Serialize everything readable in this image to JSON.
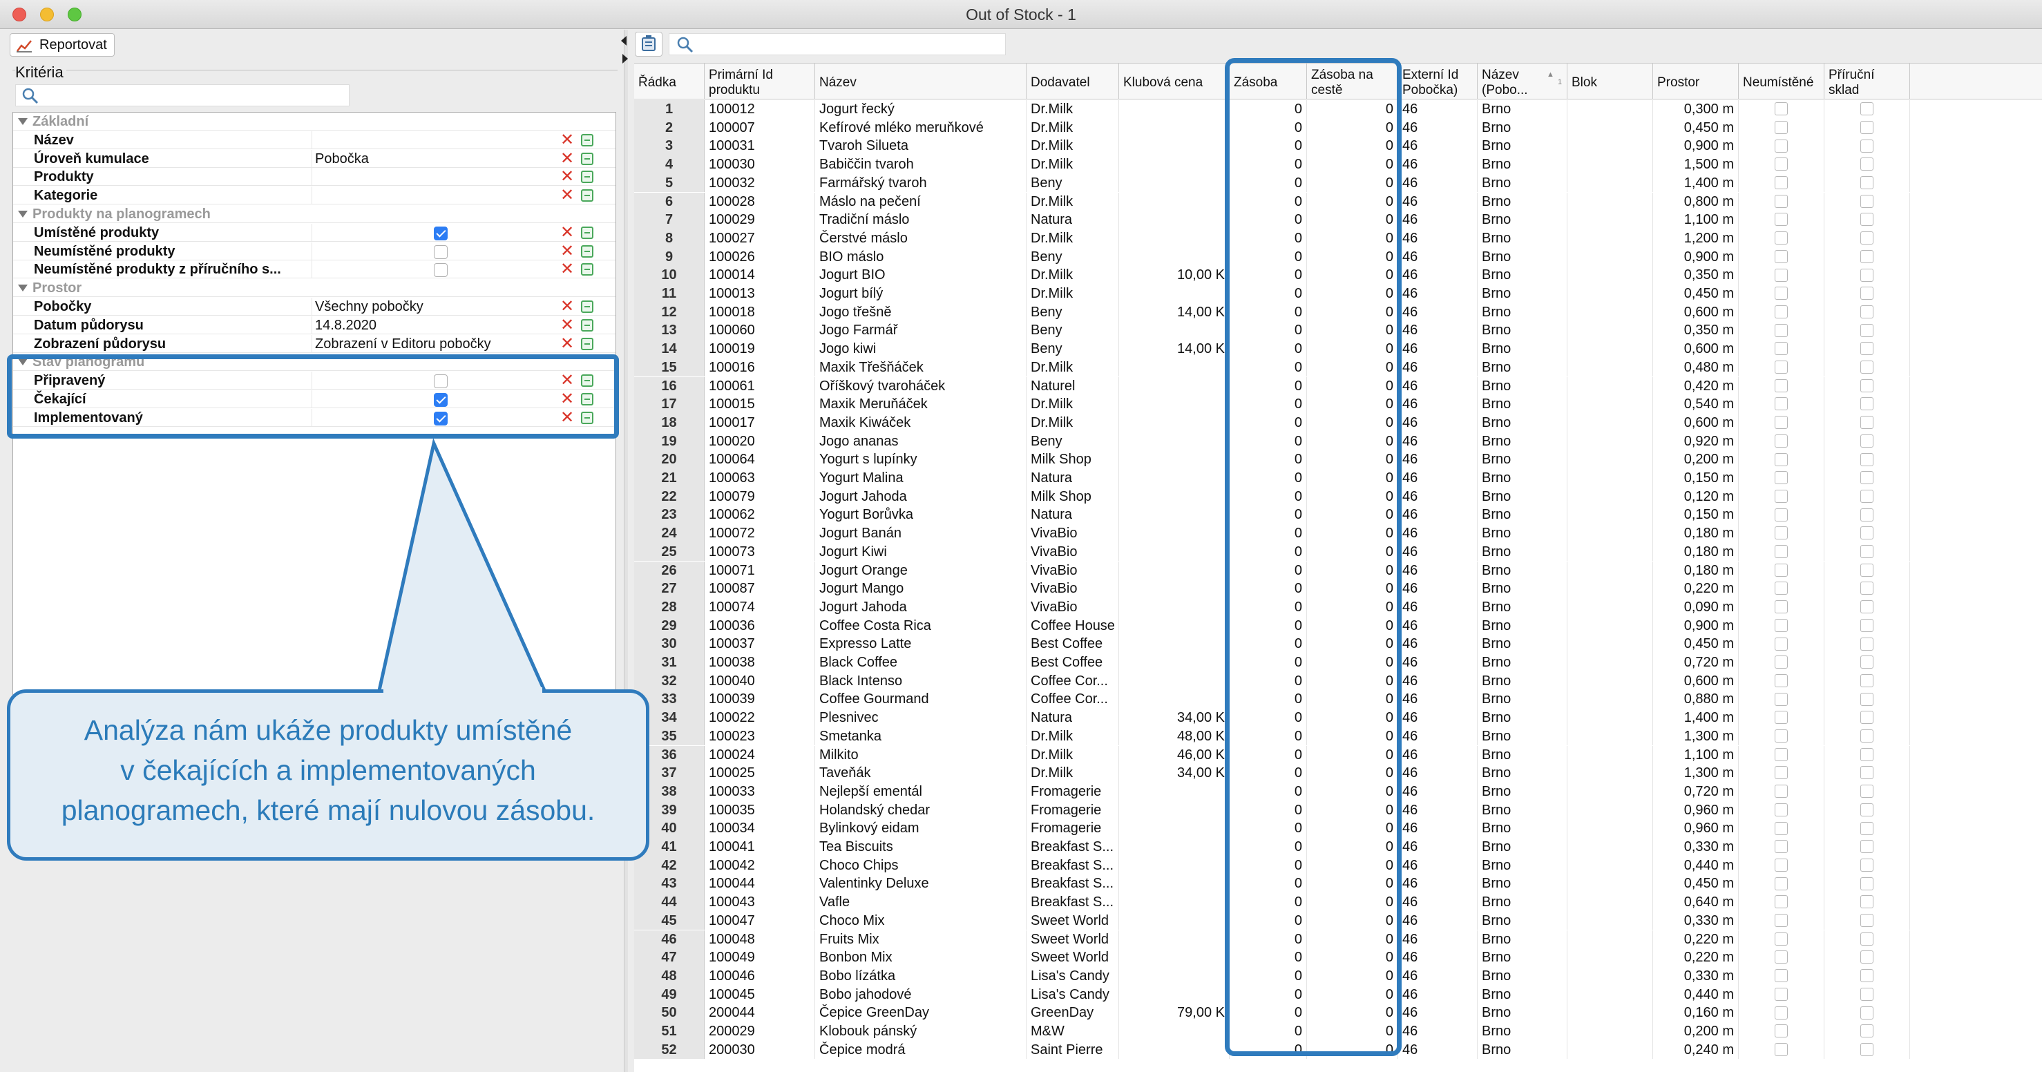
{
  "window": {
    "title": "Out of Stock - 1"
  },
  "left_panel": {
    "report_button": "Reportovat",
    "criteria_title": "Kritéria",
    "rows": [
      {
        "type": "group",
        "label": "Základní"
      },
      {
        "type": "item",
        "label": "Název",
        "value": "",
        "checkbox": null
      },
      {
        "type": "item",
        "label": "Úroveň kumulace",
        "value": "Pobočka",
        "checkbox": null
      },
      {
        "type": "item",
        "label": "Produkty",
        "value": "",
        "checkbox": null
      },
      {
        "type": "item",
        "label": "Kategorie",
        "value": "",
        "checkbox": null
      },
      {
        "type": "group",
        "label": "Produkty na planogramech"
      },
      {
        "type": "item",
        "label": "Umístěné produkty",
        "value": "",
        "checkbox": true
      },
      {
        "type": "item",
        "label": "Neumístěné produkty",
        "value": "",
        "checkbox": false
      },
      {
        "type": "item",
        "label": "Neumístěné produkty z příručního s...",
        "value": "",
        "checkbox": false
      },
      {
        "type": "group",
        "label": "Prostor"
      },
      {
        "type": "item",
        "label": "Pobočky",
        "value": "Všechny pobočky",
        "checkbox": null
      },
      {
        "type": "item",
        "label": "Datum půdorysu",
        "value": "14.8.2020",
        "checkbox": null
      },
      {
        "type": "item",
        "label": "Zobrazení půdorysu",
        "value": "Zobrazení v Editoru pobočky",
        "checkbox": null
      },
      {
        "type": "group",
        "label": "Stav planogramu"
      },
      {
        "type": "item",
        "label": "Připravený",
        "value": "",
        "checkbox": false
      },
      {
        "type": "item",
        "label": "Čekající",
        "value": "",
        "checkbox": true
      },
      {
        "type": "item",
        "label": "Implementovaný",
        "value": "",
        "checkbox": true
      }
    ]
  },
  "callout": {
    "lines": [
      "Analýza nám ukáže produkty umístěné",
      "v čekajících a implementovaných",
      "planogramech, které mají nulovou zásobu."
    ]
  },
  "colors": {
    "highlight": "#2f7bbd",
    "callout_bg": "#e3edf5",
    "checkbox_on": "#2c7df4",
    "remove": "#d9352a"
  },
  "table": {
    "columns": [
      "Řádka",
      "Primární Id\nproduktu",
      "Název",
      "Dodavatel",
      "Klubová cena",
      "Zásoba",
      "Zásoba na\ncestě",
      "Externí Id\nPobočka)",
      "Název\n(Pobo...",
      "Blok",
      "Prostor",
      "Neumístěné",
      "Příruční\nsklad"
    ],
    "sort_indicator": "1",
    "rows": [
      [
        "1",
        "100012",
        "Jogurt řecký",
        "Dr.Milk",
        "",
        "0",
        "0",
        "46",
        "Brno",
        "",
        "0,300 m"
      ],
      [
        "2",
        "100007",
        "Kefírové mléko meruňkové",
        "Dr.Milk",
        "",
        "0",
        "0",
        "46",
        "Brno",
        "",
        "0,450 m"
      ],
      [
        "3",
        "100031",
        "Tvaroh Silueta",
        "Dr.Milk",
        "",
        "0",
        "0",
        "46",
        "Brno",
        "",
        "0,900 m"
      ],
      [
        "4",
        "100030",
        "Babiččin tvaroh",
        "Dr.Milk",
        "",
        "0",
        "0",
        "46",
        "Brno",
        "",
        "1,500 m"
      ],
      [
        "5",
        "100032",
        "Farmářský tvaroh",
        "Beny",
        "",
        "0",
        "0",
        "46",
        "Brno",
        "",
        "1,400 m"
      ],
      [
        "6",
        "100028",
        "Máslo na pečení",
        "Dr.Milk",
        "",
        "0",
        "0",
        "46",
        "Brno",
        "",
        "0,800 m"
      ],
      [
        "7",
        "100029",
        "Tradiční máslo",
        "Natura",
        "",
        "0",
        "0",
        "46",
        "Brno",
        "",
        "1,100 m"
      ],
      [
        "8",
        "100027",
        "Čerstvé máslo",
        "Dr.Milk",
        "",
        "0",
        "0",
        "46",
        "Brno",
        "",
        "1,200 m"
      ],
      [
        "9",
        "100026",
        "BIO máslo",
        "Beny",
        "",
        "0",
        "0",
        "46",
        "Brno",
        "",
        "0,900 m"
      ],
      [
        "10",
        "100014",
        "Jogurt BIO",
        "Dr.Milk",
        "10,00 K",
        "0",
        "0",
        "46",
        "Brno",
        "",
        "0,350 m"
      ],
      [
        "11",
        "100013",
        "Jogurt bílý",
        "Dr.Milk",
        "",
        "0",
        "0",
        "46",
        "Brno",
        "",
        "0,450 m"
      ],
      [
        "12",
        "100018",
        "Jogo třešně",
        "Beny",
        "14,00 K",
        "0",
        "0",
        "46",
        "Brno",
        "",
        "0,600 m"
      ],
      [
        "13",
        "100060",
        "Jogo Farmář",
        "Beny",
        "",
        "0",
        "0",
        "46",
        "Brno",
        "",
        "0,350 m"
      ],
      [
        "14",
        "100019",
        "Jogo kiwi",
        "Beny",
        "14,00 K",
        "0",
        "0",
        "46",
        "Brno",
        "",
        "0,600 m"
      ],
      [
        "15",
        "100016",
        "Maxik Třešňáček",
        "Dr.Milk",
        "",
        "0",
        "0",
        "46",
        "Brno",
        "",
        "0,480 m"
      ],
      [
        "16",
        "100061",
        "Oříškový tvaroháček",
        "Naturel",
        "",
        "0",
        "0",
        "46",
        "Brno",
        "",
        "0,420 m"
      ],
      [
        "17",
        "100015",
        "Maxik Meruňáček",
        "Dr.Milk",
        "",
        "0",
        "0",
        "46",
        "Brno",
        "",
        "0,540 m"
      ],
      [
        "18",
        "100017",
        "Maxik Kiwáček",
        "Dr.Milk",
        "",
        "0",
        "0",
        "46",
        "Brno",
        "",
        "0,600 m"
      ],
      [
        "19",
        "100020",
        "Jogo ananas",
        "Beny",
        "",
        "0",
        "0",
        "46",
        "Brno",
        "",
        "0,920 m"
      ],
      [
        "20",
        "100064",
        "Yogurt s lupínky",
        "Milk Shop",
        "",
        "0",
        "0",
        "46",
        "Brno",
        "",
        "0,200 m"
      ],
      [
        "21",
        "100063",
        "Yogurt Malina",
        "Natura",
        "",
        "0",
        "0",
        "46",
        "Brno",
        "",
        "0,150 m"
      ],
      [
        "22",
        "100079",
        "Jogurt Jahoda",
        "Milk Shop",
        "",
        "0",
        "0",
        "46",
        "Brno",
        "",
        "0,120 m"
      ],
      [
        "23",
        "100062",
        "Yogurt Borůvka",
        "Natura",
        "",
        "0",
        "0",
        "46",
        "Brno",
        "",
        "0,150 m"
      ],
      [
        "24",
        "100072",
        "Jogurt Banán",
        "VivaBio",
        "",
        "0",
        "0",
        "46",
        "Brno",
        "",
        "0,180 m"
      ],
      [
        "25",
        "100073",
        "Jogurt Kiwi",
        "VivaBio",
        "",
        "0",
        "0",
        "46",
        "Brno",
        "",
        "0,180 m"
      ],
      [
        "26",
        "100071",
        "Jogurt Orange",
        "VivaBio",
        "",
        "0",
        "0",
        "46",
        "Brno",
        "",
        "0,180 m"
      ],
      [
        "27",
        "100087",
        "Jogurt Mango",
        "VivaBio",
        "",
        "0",
        "0",
        "46",
        "Brno",
        "",
        "0,220 m"
      ],
      [
        "28",
        "100074",
        "Jogurt Jahoda",
        "VivaBio",
        "",
        "0",
        "0",
        "46",
        "Brno",
        "",
        "0,090 m"
      ],
      [
        "29",
        "100036",
        "Coffee Costa Rica",
        "Coffee House",
        "",
        "0",
        "0",
        "46",
        "Brno",
        "",
        "0,900 m"
      ],
      [
        "30",
        "100037",
        "Expresso Latte",
        "Best Coffee",
        "",
        "0",
        "0",
        "46",
        "Brno",
        "",
        "0,450 m"
      ],
      [
        "31",
        "100038",
        "Black Coffee",
        "Best Coffee",
        "",
        "0",
        "0",
        "46",
        "Brno",
        "",
        "0,720 m"
      ],
      [
        "32",
        "100040",
        "Black Intenso",
        "Coffee Cor...",
        "",
        "0",
        "0",
        "46",
        "Brno",
        "",
        "0,600 m"
      ],
      [
        "33",
        "100039",
        "Coffee Gourmand",
        "Coffee Cor...",
        "",
        "0",
        "0",
        "46",
        "Brno",
        "",
        "0,880 m"
      ],
      [
        "34",
        "100022",
        "Plesnivec",
        "Natura",
        "34,00 K",
        "0",
        "0",
        "46",
        "Brno",
        "",
        "1,400 m"
      ],
      [
        "35",
        "100023",
        "Smetanka",
        "Dr.Milk",
        "48,00 K",
        "0",
        "0",
        "46",
        "Brno",
        "",
        "1,300 m"
      ],
      [
        "36",
        "100024",
        "Milkito",
        "Dr.Milk",
        "46,00 K",
        "0",
        "0",
        "46",
        "Brno",
        "",
        "1,100 m"
      ],
      [
        "37",
        "100025",
        "Taveňák",
        "Dr.Milk",
        "34,00 K",
        "0",
        "0",
        "46",
        "Brno",
        "",
        "1,300 m"
      ],
      [
        "38",
        "100033",
        "Nejlepší ementál",
        "Fromagerie",
        "",
        "0",
        "0",
        "46",
        "Brno",
        "",
        "0,720 m"
      ],
      [
        "39",
        "100035",
        "Holandský chedar",
        "Fromagerie",
        "",
        "0",
        "0",
        "46",
        "Brno",
        "",
        "0,960 m"
      ],
      [
        "40",
        "100034",
        "Bylinkový eidam",
        "Fromagerie",
        "",
        "0",
        "0",
        "46",
        "Brno",
        "",
        "0,960 m"
      ],
      [
        "41",
        "100041",
        "Tea Biscuits",
        "Breakfast S...",
        "",
        "0",
        "0",
        "46",
        "Brno",
        "",
        "0,330 m"
      ],
      [
        "42",
        "100042",
        "Choco Chips",
        "Breakfast S...",
        "",
        "0",
        "0",
        "46",
        "Brno",
        "",
        "0,440 m"
      ],
      [
        "43",
        "100044",
        "Valentinky Deluxe",
        "Breakfast S...",
        "",
        "0",
        "0",
        "46",
        "Brno",
        "",
        "0,450 m"
      ],
      [
        "44",
        "100043",
        "Vafle",
        "Breakfast S...",
        "",
        "0",
        "0",
        "46",
        "Brno",
        "",
        "0,640 m"
      ],
      [
        "45",
        "100047",
        "Choco Mix",
        "Sweet World",
        "",
        "0",
        "0",
        "46",
        "Brno",
        "",
        "0,330 m"
      ],
      [
        "46",
        "100048",
        "Fruits Mix",
        "Sweet World",
        "",
        "0",
        "0",
        "46",
        "Brno",
        "",
        "0,220 m"
      ],
      [
        "47",
        "100049",
        "Bonbon Mix",
        "Sweet World",
        "",
        "0",
        "0",
        "46",
        "Brno",
        "",
        "0,220 m"
      ],
      [
        "48",
        "100046",
        "Bobo lízátka",
        "Lisa's Candy",
        "",
        "0",
        "0",
        "46",
        "Brno",
        "",
        "0,330 m"
      ],
      [
        "49",
        "100045",
        "Bobo jahodové",
        "Lisa's Candy",
        "",
        "0",
        "0",
        "46",
        "Brno",
        "",
        "0,440 m"
      ],
      [
        "50",
        "200044",
        "Čepice GreenDay",
        "GreenDay",
        "79,00 K",
        "0",
        "0",
        "46",
        "Brno",
        "",
        "0,160 m"
      ],
      [
        "51",
        "200029",
        "Klobouk pánský",
        "M&W",
        "",
        "0",
        "0",
        "46",
        "Brno",
        "",
        "0,200 m"
      ],
      [
        "52",
        "200030",
        "Čepice modrá",
        "Saint Pierre",
        "",
        "0",
        "0",
        "46",
        "Brno",
        "",
        "0,240 m"
      ]
    ]
  }
}
